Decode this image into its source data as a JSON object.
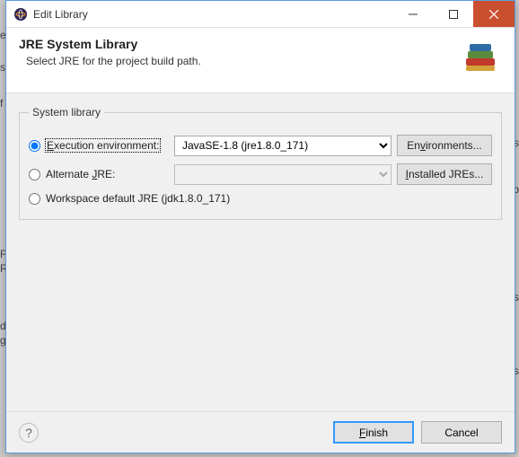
{
  "titlebar": {
    "title": "Edit Library"
  },
  "header": {
    "title": "JRE System Library",
    "subtitle": "Select JRE for the project build path."
  },
  "group": {
    "legend": "System library",
    "exec_env_label_pre": "E",
    "exec_env_label_post": "xecution environment:",
    "exec_env_value": "JavaSE-1.8 (jre1.8.0_171)",
    "environments_btn_pre": "En",
    "environments_btn_u": "v",
    "environments_btn_post": "ironments...",
    "alt_jre_label_pre": "Alternate ",
    "alt_jre_label_u": "J",
    "alt_jre_label_post": "RE:",
    "installed_jres_btn_u": "I",
    "installed_jres_btn_post": "nstalled JREs...",
    "workspace_label": "Workspace default JRE (jdk1.8.0_171)"
  },
  "footer": {
    "finish_pre": "",
    "finish_u": "F",
    "finish_post": "inish",
    "cancel": "Cancel"
  },
  "bg": {
    "f0": "ex",
    "f1": "s",
    "f2": "f",
    "f3": "F",
    "f4": "R",
    "f5": "d",
    "f6": "g",
    "f7": "Rs",
    "f8": "b",
    "f9": "as",
    "f10": "es"
  }
}
